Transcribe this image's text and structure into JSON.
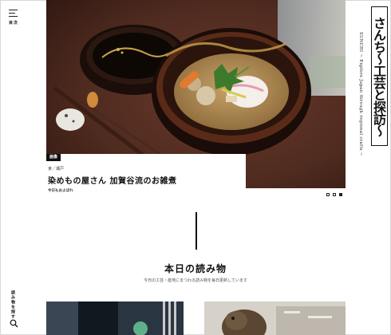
{
  "nav": {
    "menu_label": "目次",
    "vertical_link": "読み物を探す",
    "icons": [
      "menu-icon",
      "search-icon"
    ]
  },
  "brand": {
    "logo": "さんち〜工芸と探訪〜",
    "tagline": "SUNCHI ~ Explore Japan through regional crafts ~"
  },
  "hero": {
    "category_badge": "画像",
    "subcategory": "食／瀬戸",
    "title": "染めもの屋さん 加賀谷流のお雑煮",
    "series": "今日もおよばれ",
    "slide_count": 3,
    "active_slide": 3
  },
  "section": {
    "title": "本日の読み物",
    "subtitle": "今日の工芸・産地にまつわる読み物を毎日更新しています"
  },
  "colors": {
    "table": "#5a2e22",
    "lacquer_red": "#7a1a10",
    "gold": "#b88a3a",
    "accent": "#111111"
  }
}
